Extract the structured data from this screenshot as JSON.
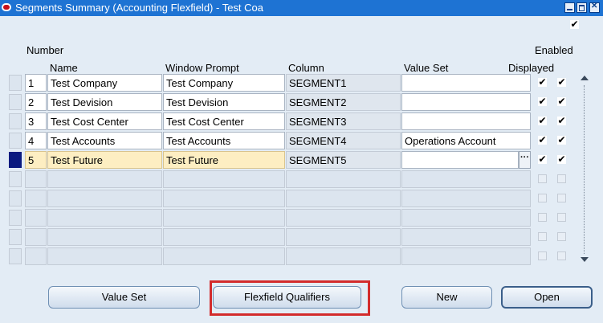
{
  "window": {
    "title": "Segments Summary (Accounting Flexfield) - Test Coa",
    "controls": [
      "minimize",
      "maximize",
      "close"
    ]
  },
  "top_checkbox": {
    "checked": true
  },
  "columns": {
    "number": "Number",
    "name": "Name",
    "window_prompt": "Window Prompt",
    "column": "Column",
    "value_set": "Value Set",
    "enabled": "Enabled",
    "displayed": "Displayed"
  },
  "rows": [
    {
      "number": "1",
      "name": "Test Company",
      "window_prompt": "Test Company",
      "column": "SEGMENT1",
      "value_set": "",
      "displayed": true,
      "enabled": true
    },
    {
      "number": "2",
      "name": "Test Devision",
      "window_prompt": "Test Devision",
      "column": "SEGMENT2",
      "value_set": "",
      "displayed": true,
      "enabled": true
    },
    {
      "number": "3",
      "name": "Test Cost Center",
      "window_prompt": "Test Cost Center",
      "column": "SEGMENT3",
      "value_set": "",
      "displayed": true,
      "enabled": true
    },
    {
      "number": "4",
      "name": "Test Accounts",
      "window_prompt": "Test Accounts",
      "column": "SEGMENT4",
      "value_set": "Operations Account",
      "displayed": true,
      "enabled": true
    },
    {
      "number": "5",
      "name": "Test Future",
      "window_prompt": "Test Future",
      "column": "SEGMENT5",
      "value_set": "",
      "displayed": true,
      "enabled": true,
      "current": true
    }
  ],
  "empty_rows": 5,
  "lov_glyph": "···",
  "buttons": {
    "value_set": "Value Set",
    "flexfield_qualifiers": "Flexfield Qualifiers",
    "new": "New",
    "open": "Open"
  },
  "colors": {
    "titlebar": "#1e73d3",
    "background": "#e3ecf5",
    "current_record": "#0a1a80",
    "current_row_fill": "#fdeec2",
    "highlight_box": "#d32c2c"
  }
}
